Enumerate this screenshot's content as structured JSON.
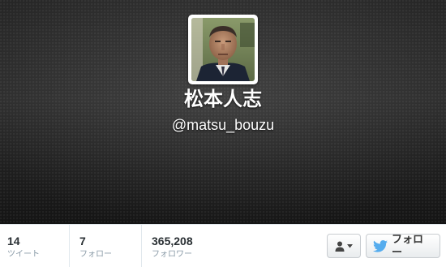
{
  "profile": {
    "name": "松本人志",
    "handle": "@matsu_bouzu"
  },
  "stats": {
    "tweets": {
      "count": "14",
      "label": "ツイート"
    },
    "following": {
      "count": "7",
      "label": "フォロー"
    },
    "followers": {
      "count": "365,208",
      "label": "フォロワー"
    }
  },
  "actions": {
    "user_menu_icon": "user-icon",
    "user_menu_caret": "caret-down-icon",
    "follow_label": "フォロー",
    "follow_icon": "twitter-bird-icon"
  },
  "colors": {
    "header_bg": "#2a2a2a",
    "name_text": "#ffffff",
    "count_text": "#292f33",
    "label_text": "#8899a6",
    "twitter_blue": "#55acee"
  }
}
